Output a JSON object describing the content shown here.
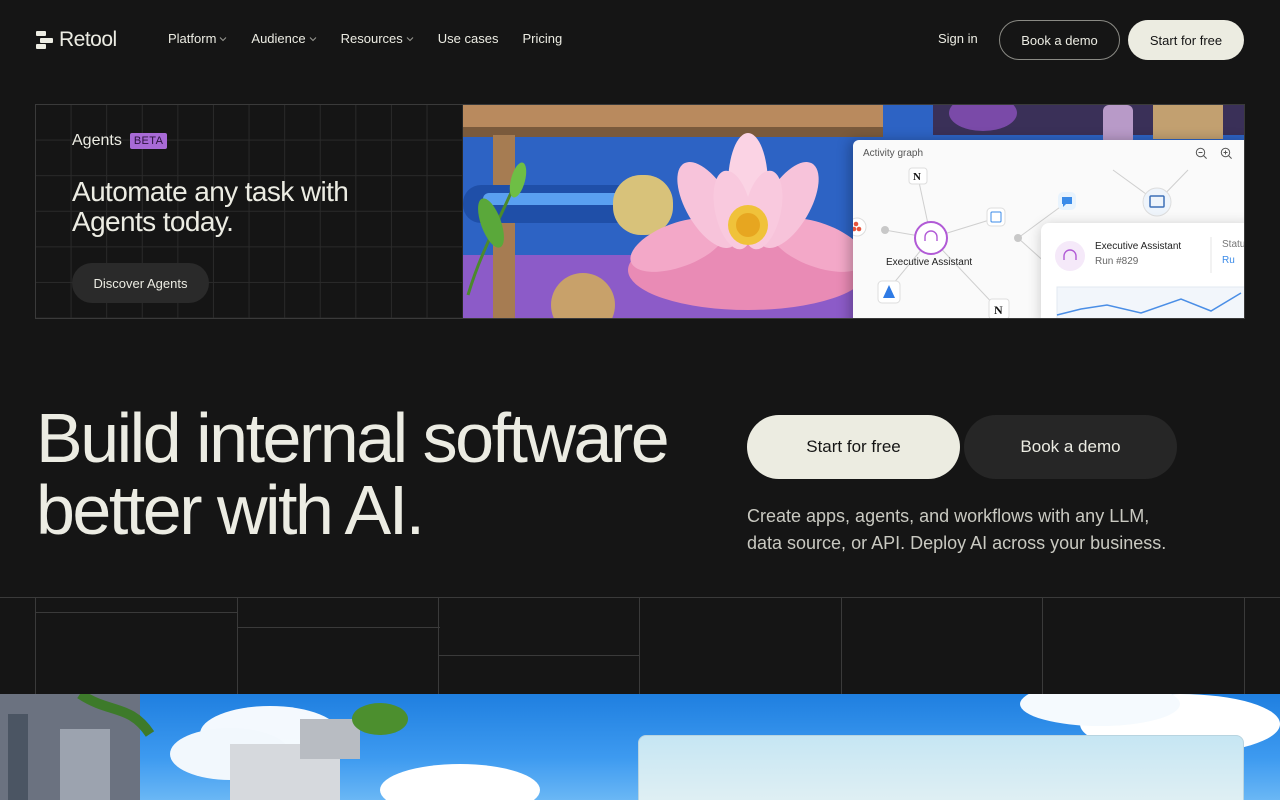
{
  "nav": {
    "logo_text": "Retool",
    "links": [
      {
        "label": "Platform",
        "dropdown": true
      },
      {
        "label": "Audience",
        "dropdown": true
      },
      {
        "label": "Resources",
        "dropdown": true
      },
      {
        "label": "Use cases",
        "dropdown": false
      },
      {
        "label": "Pricing",
        "dropdown": false
      }
    ],
    "sign_in": "Sign in",
    "book_demo": "Book a demo",
    "start_free": "Start for free"
  },
  "banner": {
    "kicker": "Agents",
    "badge": "BETA",
    "title": "Automate any task with Agents today.",
    "cta": "Discover Agents",
    "graph": {
      "header": "Activity graph",
      "node_label": "Executive Assistant",
      "detail_title": "Executive Assistant",
      "detail_run": "Run #829",
      "detail_status_label": "Statu",
      "detail_status_value": "Ru"
    }
  },
  "hero": {
    "title": "Build internal software better with AI.",
    "primary_cta": "Start for free",
    "secondary_cta": "Book a demo",
    "subtitle": "Create apps, agents, and workflows with any LLM, data source, or API. Deploy AI across your business."
  },
  "colors": {
    "background": "#151515",
    "text": "#ecece3",
    "primary_button": "#ecece1",
    "beta_badge": "#a86ad6",
    "agent_accent": "#b15ad6"
  }
}
